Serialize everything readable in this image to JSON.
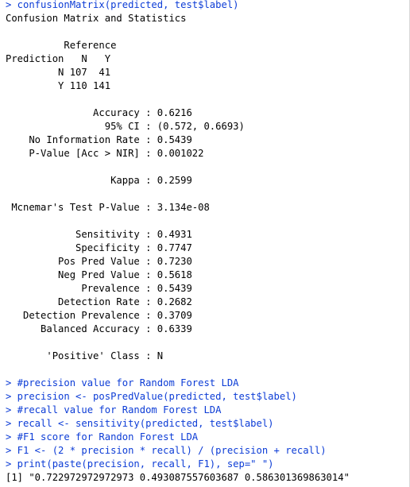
{
  "console": {
    "colors": {
      "command": "#0c3cd6",
      "output": "#000000",
      "background": "#ffffff"
    },
    "lines": [
      {
        "kind": "command",
        "text": "> confusionMatrix(predicted, test$label)"
      },
      {
        "kind": "output",
        "text": "Confusion Matrix and Statistics"
      },
      {
        "kind": "blank",
        "text": ""
      },
      {
        "kind": "output",
        "text": "          Reference"
      },
      {
        "kind": "output",
        "text": "Prediction   N   Y"
      },
      {
        "kind": "output",
        "text": "         N 107  41"
      },
      {
        "kind": "output",
        "text": "         Y 110 141"
      },
      {
        "kind": "blank",
        "text": ""
      },
      {
        "kind": "output",
        "text": "               Accuracy : 0.6216"
      },
      {
        "kind": "output",
        "text": "                 95% CI : (0.572, 0.6693)"
      },
      {
        "kind": "output",
        "text": "    No Information Rate : 0.5439"
      },
      {
        "kind": "output",
        "text": "    P-Value [Acc > NIR] : 0.001022"
      },
      {
        "kind": "blank",
        "text": ""
      },
      {
        "kind": "output",
        "text": "                  Kappa : 0.2599"
      },
      {
        "kind": "blank",
        "text": ""
      },
      {
        "kind": "output",
        "text": " Mcnemar's Test P-Value : 3.134e-08"
      },
      {
        "kind": "blank",
        "text": ""
      },
      {
        "kind": "output",
        "text": "            Sensitivity : 0.4931"
      },
      {
        "kind": "output",
        "text": "            Specificity : 0.7747"
      },
      {
        "kind": "output",
        "text": "         Pos Pred Value : 0.7230"
      },
      {
        "kind": "output",
        "text": "         Neg Pred Value : 0.5618"
      },
      {
        "kind": "output",
        "text": "             Prevalence : 0.5439"
      },
      {
        "kind": "output",
        "text": "         Detection Rate : 0.2682"
      },
      {
        "kind": "output",
        "text": "   Detection Prevalence : 0.3709"
      },
      {
        "kind": "output",
        "text": "      Balanced Accuracy : 0.6339"
      },
      {
        "kind": "blank",
        "text": ""
      },
      {
        "kind": "output",
        "text": "       'Positive' Class : N"
      },
      {
        "kind": "blank",
        "text": ""
      },
      {
        "kind": "command",
        "text": "> #precision value for Random Forest LDA"
      },
      {
        "kind": "command",
        "text": "> precision <- posPredValue(predicted, test$label)"
      },
      {
        "kind": "command",
        "text": "> #recall value for Random Forest LDA"
      },
      {
        "kind": "command",
        "text": "> recall <- sensitivity(predicted, test$label)"
      },
      {
        "kind": "command",
        "text": "> #F1 score for Randon Forest LDA"
      },
      {
        "kind": "command",
        "text": "> F1 <- (2 * precision * recall) / (precision + recall)"
      },
      {
        "kind": "command",
        "text": "> print(paste(precision, recall, F1), sep=\" \")"
      },
      {
        "kind": "output",
        "text": "[1] \"0.722972972972973 0.493087557603687 0.586301369863014\""
      }
    ]
  }
}
